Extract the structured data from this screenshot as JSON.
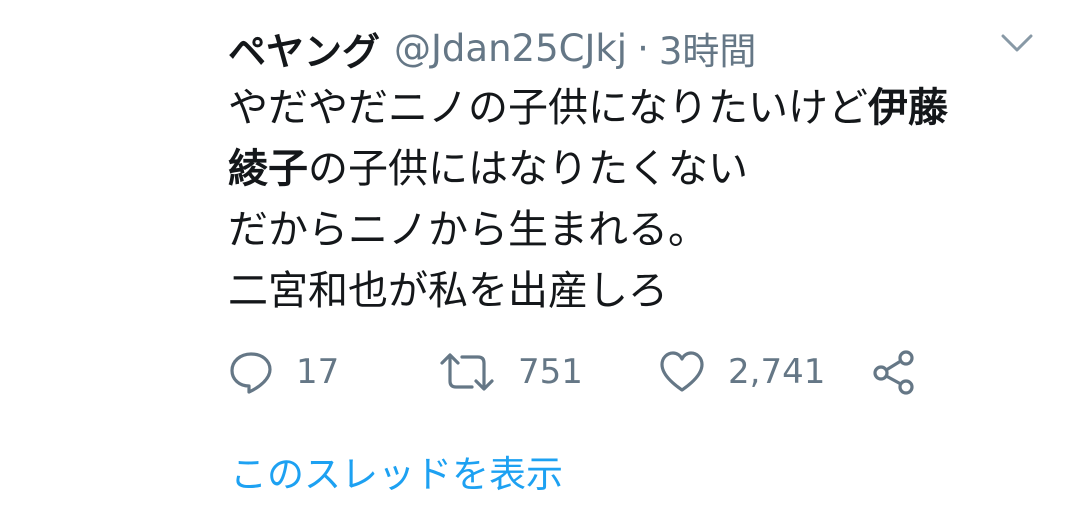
{
  "tweet": {
    "display_name": "ペヤング",
    "handle": "@Jdan25CJkj",
    "separator": "·",
    "time": "3時間",
    "body": {
      "line1_a": "やだやだニノの子供になりたいけど",
      "line1_b": "伊藤",
      "line2_a": "綾子",
      "line2_b": "の子供にはなりたくない",
      "line3": "だからニノから生まれる。",
      "line4": "二宮和也が私を出産しろ"
    },
    "actions": {
      "reply_count": "17",
      "retweet_count": "751",
      "like_count": "2,741"
    },
    "thread_link": "このスレッドを表示",
    "icons": {
      "menu": "chevron-down-icon",
      "reply": "reply-icon",
      "retweet": "retweet-icon",
      "like": "heart-icon",
      "share": "share-icon"
    },
    "colors": {
      "text": "#14171a",
      "secondary": "#657786",
      "link": "#1da1f2"
    }
  }
}
